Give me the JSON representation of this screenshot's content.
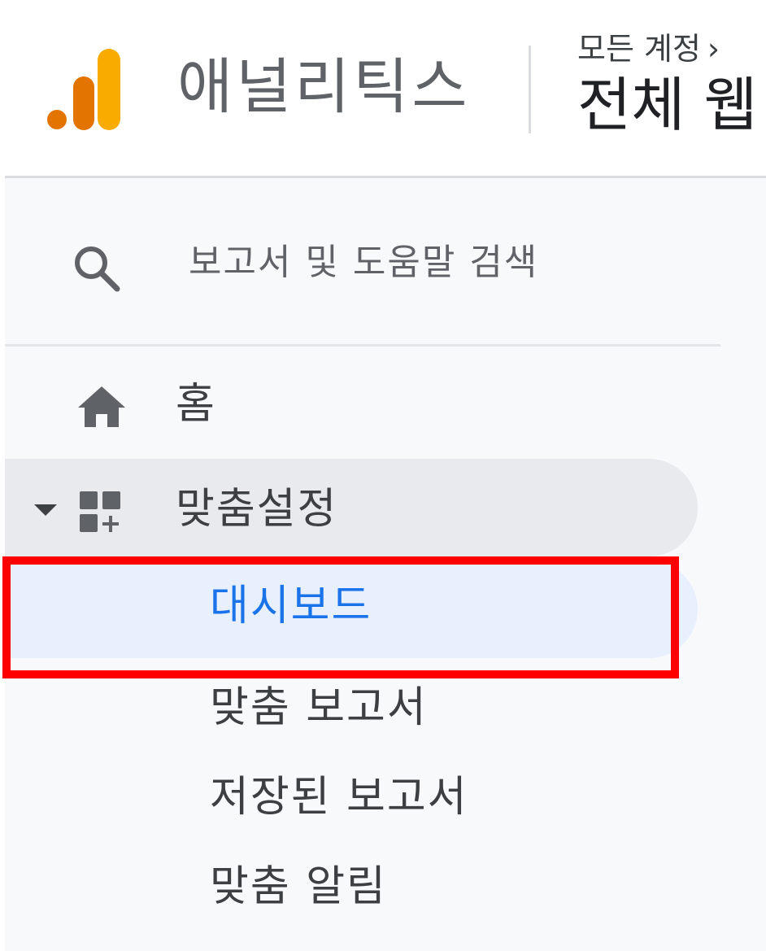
{
  "header": {
    "logo_icon": "analytics-bar-logo-icon",
    "app_name": "애널리틱스",
    "breadcrumb": "모든 계정",
    "breadcrumb_chevron": "›",
    "property_name": "전체 웹"
  },
  "search": {
    "icon": "search-icon",
    "label": "보고서 및 도움말 검색"
  },
  "nav": {
    "home": {
      "icon": "home-icon",
      "label": "홈"
    },
    "customization": {
      "expand_icon": "caret-down-icon",
      "icon": "dashboard-add-icon",
      "label": "맞춤설정",
      "expanded": true,
      "children": [
        {
          "label": "대시보드",
          "selected": true
        },
        {
          "label": "맞춤 보고서",
          "selected": false
        },
        {
          "label": "저장된 보고서",
          "selected": false
        },
        {
          "label": "맞춤 알림",
          "selected": false
        }
      ]
    }
  },
  "highlight": {
    "target": "대시보드",
    "color": "#ff0000"
  },
  "colors": {
    "logo_orange_light": "#f9ab00",
    "logo_orange_dark": "#e37400",
    "selected_text": "#1a73e8",
    "selected_bg": "#e8f0fe",
    "expanded_bg": "#e8eaed",
    "sidebar_bg": "#f8f9fa"
  }
}
